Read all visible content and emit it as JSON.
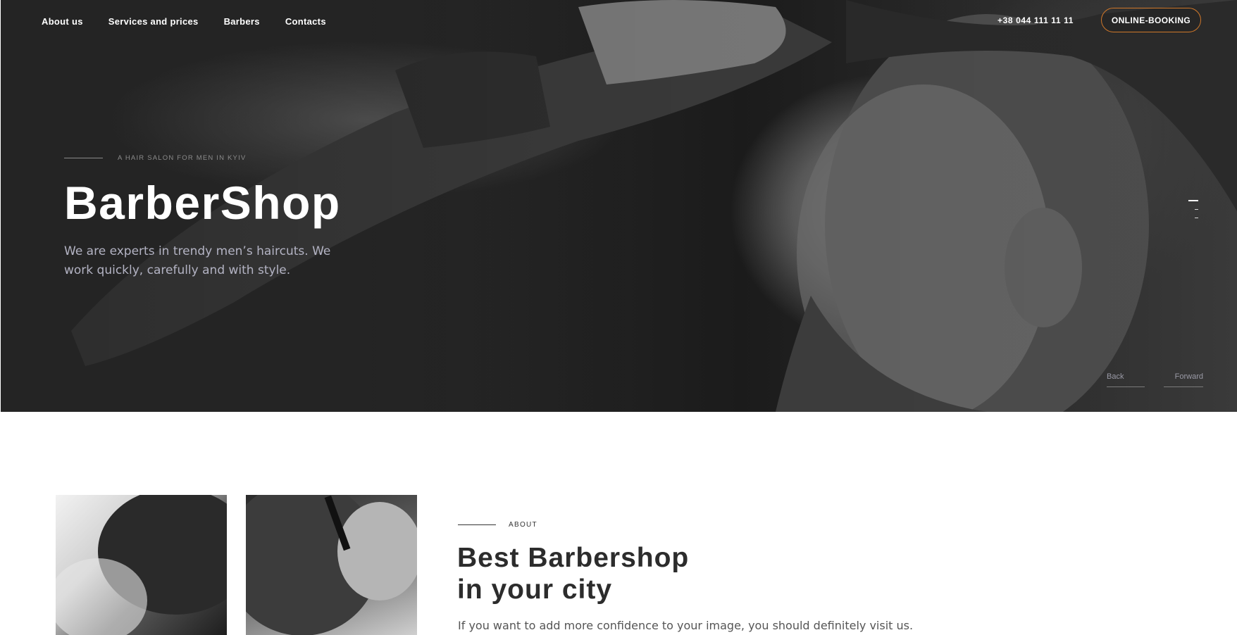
{
  "header": {
    "nav": [
      "About us",
      "Services and prices",
      "Barbers",
      "Contacts"
    ],
    "phone": "+38 044 111 11 11",
    "booking_label": "ONLINE-BOOKING"
  },
  "hero": {
    "tagline": "A HAIR SALON FOR MEN IN KYIV",
    "title": "BarberShop",
    "description": "We are experts in trendy men’s haircuts. We work quickly, carefully and with style.",
    "slides_total": 3,
    "slide_active": 1,
    "back_label": "Back",
    "forward_label": "Forward"
  },
  "about": {
    "label": "ABOUT",
    "title_line1": "Best Barbershop",
    "title_line2": "in your city",
    "text": "If you want to add more confidence to your image, you should definitely visit us."
  },
  "colors": {
    "accent": "#d0782a",
    "hero_text": "#ffffff",
    "hero_muted": "#b3b3c3",
    "heading_dark": "#2c2c2c"
  }
}
